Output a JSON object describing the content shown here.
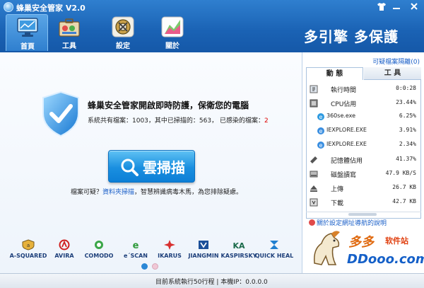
{
  "window": {
    "title": "蜂巢安全管家 V2.0"
  },
  "nav": {
    "tabs": [
      {
        "label": "首頁"
      },
      {
        "label": "工具"
      },
      {
        "label": "設定"
      },
      {
        "label": "關於"
      }
    ]
  },
  "header": {
    "slogan": "多引擎  多保護"
  },
  "main": {
    "headline": "蜂巢安全管家開啟即時防護，保衛您的電腦",
    "stats": {
      "prefix": "系統共有檔案：1003，其中已掃描的：563， 已感染的檔案：",
      "infected": "2"
    },
    "scan_button": "雲掃描",
    "suspicious": {
      "prefix": "檔案可疑？",
      "link": "資料夾掃描",
      "suffix": "，智慧辨識病毒木馬，為您排除疑慮。"
    },
    "engines": [
      {
        "label": "A-SQUARED",
        "icon": "a-squared-icon"
      },
      {
        "label": "AVIRA",
        "icon": "avira-icon"
      },
      {
        "label": "COMODO",
        "icon": "comodo-icon"
      },
      {
        "label": "e´SCAN",
        "icon": "escan-icon"
      },
      {
        "label": "IKARUS",
        "icon": "ikarus-icon"
      },
      {
        "label": "JIANGMIN",
        "icon": "jiangmin-icon"
      },
      {
        "label": "KASPIRSKY",
        "icon": "kaspersky-icon"
      },
      {
        "label": "QUICK HEAL",
        "icon": "quick-heal-icon"
      }
    ]
  },
  "panel": {
    "quarantine_link": "可疑檔案隔離(0)",
    "tabs": [
      "動 態",
      "工 具"
    ],
    "rows": [
      {
        "label": "執行時間",
        "value": "0:0:28",
        "icon": "clock-icon"
      },
      {
        "label": "CPU佔用",
        "value": "23.44%",
        "icon": "cpu-icon"
      },
      {
        "label": "360se.exe",
        "value": "6.25%",
        "icon": "browser-icon"
      },
      {
        "label": "IEXPLORE.EXE",
        "value": "3.91%",
        "icon": "ie-icon"
      },
      {
        "label": "IEXPLORE.EXE",
        "value": "2.34%",
        "icon": "ie-icon"
      },
      {
        "label": "記憶體佔用",
        "value": "41.37%",
        "icon": "memory-icon"
      },
      {
        "label": "磁盤讀寫",
        "value": "47.9 KB/S",
        "icon": "disk-icon"
      },
      {
        "label": "上傳",
        "value": "26.7 KB",
        "icon": "upload-icon"
      },
      {
        "label": "下載",
        "value": "42.7 KB",
        "icon": "download-icon"
      }
    ],
    "help_link": "關於設定網址導航的說明",
    "watermark": {
      "title": "多多",
      "subtitle": "软件站",
      "domain": "DDooo.com"
    }
  },
  "status_bar": {
    "text": "目前系統執行50行程  |  本機IP：0.0.0.0"
  },
  "colors": {
    "header": "#1a62b4",
    "accent": "#1a8fe0",
    "link": "#1a5fc8",
    "alert": "#d00000"
  }
}
